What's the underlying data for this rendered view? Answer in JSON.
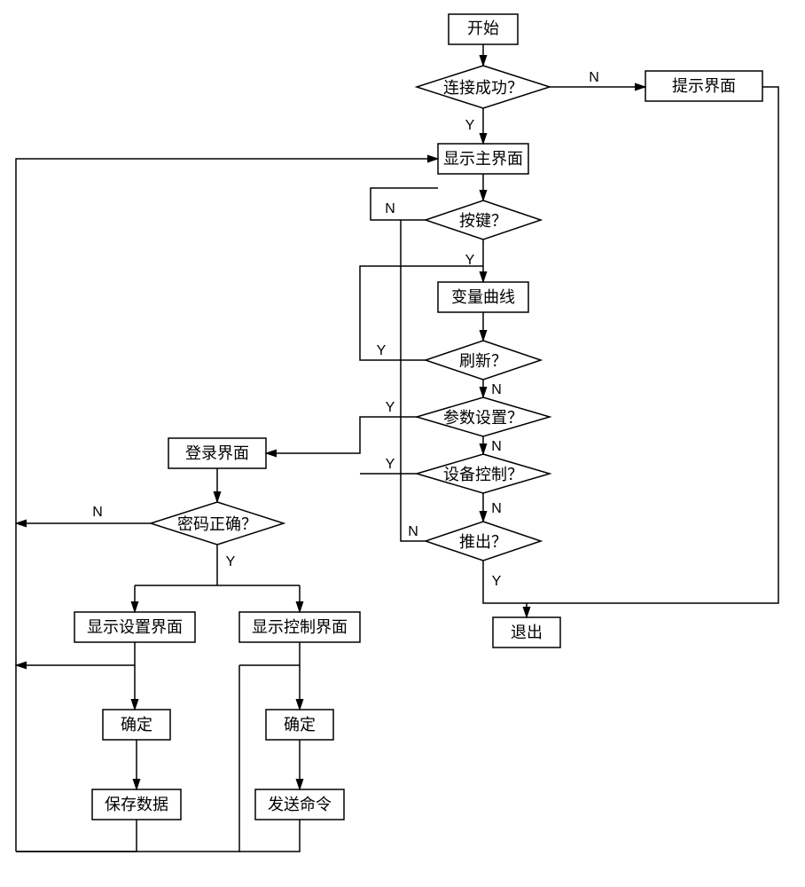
{
  "nodes": {
    "start": "开始",
    "connect_ok": "连接成功？",
    "prompt_ui": "提示界面",
    "main_ui": "显示主界面",
    "key_press": "按键？",
    "var_curve": "变量曲线",
    "refresh": "刷新？",
    "param_set": "参数设置？",
    "login_ui": "登录界面",
    "dev_ctrl": "设备控制？",
    "pw_ok": "密码正确？",
    "exit_q": "推出？",
    "show_set_ui": "显示设置界面",
    "show_ctrl_ui": "显示控制界面",
    "exit": "退出",
    "confirm1": "确定",
    "confirm2": "确定",
    "save_data": "保存数据",
    "send_cmd": "发送命令"
  },
  "labels": {
    "Y": "Y",
    "N": "N"
  }
}
